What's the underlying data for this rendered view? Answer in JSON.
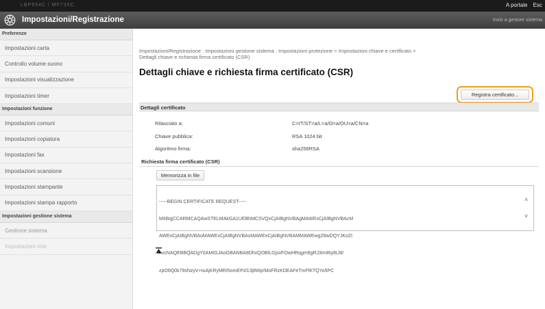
{
  "topbar": {
    "model": "LBP654C / MF735C",
    "portal_link": "A portale",
    "exit_link": "Esc"
  },
  "header": {
    "title": "Impostazioni/Registrazione",
    "right_link": "Invio a gestore sistema"
  },
  "sidebar": {
    "sections": [
      {
        "label": "Preferenze",
        "items": [
          "Impostazioni carta",
          "Controllo volume suono",
          "Impostazioni visualizzazione",
          "Impostazioni timer"
        ]
      },
      {
        "label": "Impostazioni funzione",
        "items": [
          "Impostazioni comuni",
          "Impostazioni copiatura",
          "Impostazioni fax",
          "Impostazioni scansione",
          "Impostazioni stampante",
          "Impostazioni stampa rapporto"
        ]
      },
      {
        "label": "Impostazioni gestione sistema",
        "items": [
          "Gestione sistema",
          "Impostazioni rete"
        ]
      }
    ]
  },
  "main": {
    "breadcrumb_line1": "Impostazioni/Registrazione : Impostazioni gestione sistema : Impostazioni protezione > Impostazioni chiave e certificato >",
    "breadcrumb_line2": "Dettagli chiave e richiesta firma certificato (CSR)",
    "page_title": "Dettagli chiave e richiesta firma certificato (CSR)",
    "register_button": "Registra certificato...",
    "details_header": "Dettagli certificato",
    "details": [
      {
        "label": "Rilasciato a:",
        "value": "C=IT/ST=a/L=a/O=a/OU=a/CN=a"
      },
      {
        "label": "Chiave pubblica:",
        "value": "RSA 1024 bit"
      },
      {
        "label": "Algoritmo firma:",
        "value": "sha256RSA"
      }
    ],
    "csr_header": "Richiesta firma certificato (CSR)",
    "save_button": "Memorizza in file",
    "csr_lines": [
      "-----BEGIN CERTIFICATE REQUEST-----",
      "MIIBqjCCARMCAQAwSTELMAkGA1UEBhMCSVQxCjAIBgNVBAgMAWExCjAIBgNVBAcM",
      "AWExCjAIBgNVBAoMAWExCjAIBgNVBAsMAWExCjAIBgNVBAMMAWEwgZ8wDQYJKoZI",
      "hvcNAQEBBQADgY0AMIGJAoGBANBA8DhxQOBlLGjsxFOwHRqgm9gRJ3m46y8Ll8/",
      "zpO6Q0k79sNzyV+tuAjKRyMRI5omEPzl13j8Wp/MoFRzKDEAFeTmFlKTQYo5PC"
    ],
    "accent_color": "#f39c12"
  }
}
